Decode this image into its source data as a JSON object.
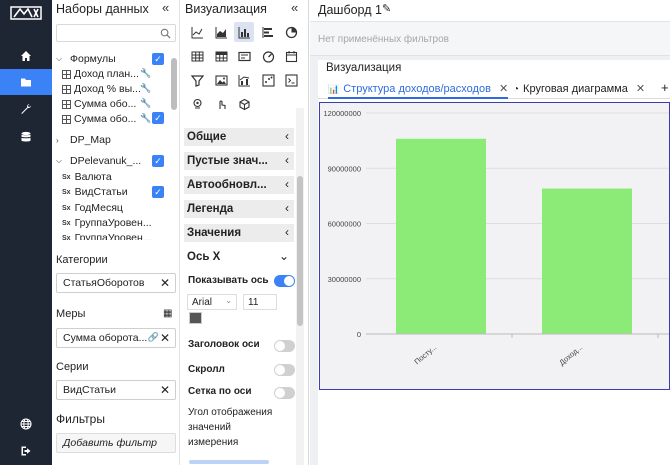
{
  "datasets_panel": {
    "title": "Наборы данных",
    "tree": [
      {
        "label": "Формулы",
        "type": "folder",
        "checked": true
      },
      {
        "label": "Доход план...",
        "type": "formula"
      },
      {
        "label": "Доход % вы...",
        "type": "formula"
      },
      {
        "label": "Сумма обо...",
        "type": "formula"
      },
      {
        "label": "Сумма обо...",
        "type": "formula",
        "checked": true
      },
      {
        "label": "DP_Map",
        "type": "dataset-collapsed"
      },
      {
        "label": "DPelevanuk_...",
        "type": "dataset",
        "checked": true
      },
      {
        "label": "Валюта",
        "type": "field"
      },
      {
        "label": "ВидСтатьи",
        "type": "field",
        "checked": true
      },
      {
        "label": "ГодМесяц",
        "type": "field"
      },
      {
        "label": "ГруппаУровен...",
        "type": "field"
      },
      {
        "label": "ГруппаУровен...",
        "type": "field"
      }
    ],
    "categories_label": "Категории",
    "categories_value": "СтатьяОборотов",
    "measures_label": "Меры",
    "measures_value": "Сумма оборота...",
    "series_label": "Серии",
    "series_value": "ВидСтатьи",
    "filters_label": "Фильтры",
    "add_filter": "Добавить фильтр"
  },
  "viz_panel": {
    "title": "Визуализация",
    "sections": [
      "Общие",
      "Пустые знач...",
      "Автообновл...",
      "Легенда",
      "Значения"
    ],
    "axis_section": "Ось X",
    "show_axis": "Показывать ось",
    "font_name": "Arial",
    "font_size": "11",
    "axis_title": "Заголовок оси",
    "scroll": "Скролл",
    "grid": "Сетка по оси",
    "angle_label_1": "Угол отображения",
    "angle_label_2": "значений",
    "angle_label_3": "измерения"
  },
  "dashboard": {
    "title": "Дашборд 1",
    "filters_placeholder": "Нет применённых фильтров",
    "card_title": "Визуализация",
    "tabs": [
      {
        "label": "Структура доходов/расходов",
        "active": true
      },
      {
        "label": "Круговая диаграмма",
        "active": false
      }
    ],
    "add_tab": "+"
  },
  "chart_data": {
    "type": "bar",
    "categories": [
      "Посту...",
      "Доход..."
    ],
    "values": [
      106000000,
      79000000
    ],
    "yticks": [
      "0",
      "30000000",
      "60000000",
      "90000000",
      "120000000"
    ],
    "ylim": [
      0,
      120000000
    ],
    "bar_color": "#8cea76",
    "grid": true
  },
  "colors": {
    "accent": "#3b82f6",
    "rail": "#1e2533",
    "chart_border": "#3b3fb0"
  }
}
